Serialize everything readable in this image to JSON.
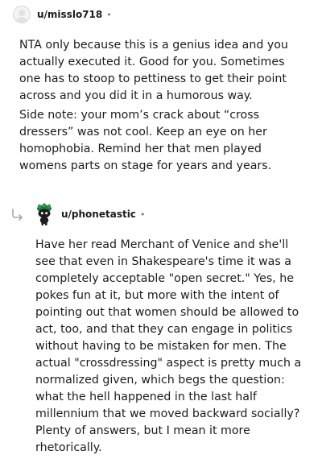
{
  "comments": [
    {
      "username": "u/misslo718",
      "separator": "•",
      "avatar_icon": "default-avatar-icon",
      "paragraphs": [
        "NTA only because this is a genius idea and you actually executed it. Good for you. Sometimes one has to stoop to pettiness to get their point across and you did it in a humorous way.",
        "Side note: your mom’s crack about “cross dressers” was not cool. Keep an eye on her homophobia. Remind her that men played womens parts on stage for years and years."
      ]
    },
    {
      "username": "u/phonetastic",
      "separator": "•",
      "avatar_icon": "snoo-avatar-icon",
      "reply_icon": "reply-arrow-icon",
      "paragraphs": [
        "Have her read Merchant of Venice and she'll see that even in Shakespeare's time it was a completely acceptable \"open secret.\" Yes, he pokes fun at it, but more with the intent of pointing out that women should be allowed to act, too, and that they can engage in politics without having to be mistaken for men. The actual \"crossdressing\" aspect is pretty much a normalized given, which begs the question: what the hell happened in the last half millennium that we moved backward socially? Plenty of answers, but I mean it more rhetorically."
      ]
    }
  ],
  "colors": {
    "text": "#1c1c1c",
    "muted": "#7c7c7c",
    "reply_arrow": "#a8a8a8",
    "snoo_hat": "#1f7a3c"
  }
}
